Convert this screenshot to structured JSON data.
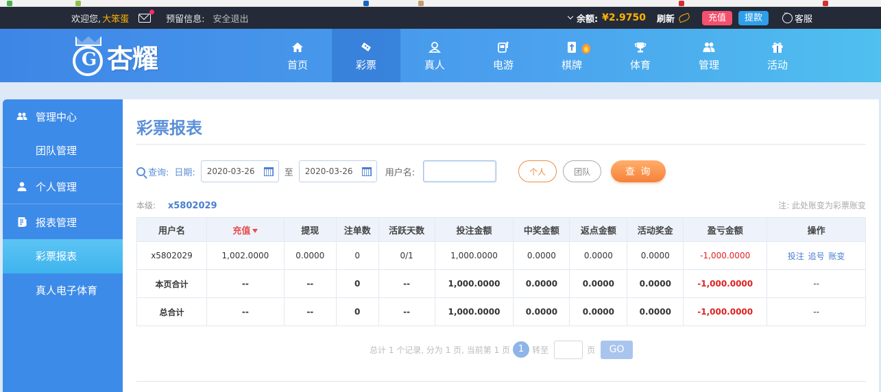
{
  "topbar": {
    "welcome": "欢迎您,",
    "username": "大笨蛋",
    "notice_label": "预留信息:",
    "logout": "安全退出",
    "balance_label": "余额:",
    "balance_value": "¥2.9750",
    "refresh": "刷新",
    "recharge": "充值",
    "withdraw": "提款",
    "service": "客服"
  },
  "logo": {
    "text": "杏耀"
  },
  "nav": [
    {
      "label": "首页",
      "icon": "home-icon"
    },
    {
      "label": "彩票",
      "icon": "ticket-icon"
    },
    {
      "label": "真人",
      "icon": "live-dealer-icon"
    },
    {
      "label": "电游",
      "icon": "slot-machine-icon"
    },
    {
      "label": "棋牌",
      "icon": "mahjong-icon"
    },
    {
      "label": "体育",
      "icon": "trophy-icon"
    },
    {
      "label": "管理",
      "icon": "users-icon"
    },
    {
      "label": "活动",
      "icon": "gift-icon"
    }
  ],
  "sidebar": {
    "management_center": "管理中心",
    "team_management": "团队管理",
    "personal_management": "个人管理",
    "report_management": "报表管理",
    "lottery_report": "彩票报表",
    "live_sports": "真人电子体育"
  },
  "main": {
    "title": "彩票报表",
    "query_label": "查询:",
    "date_label": "日期:",
    "date_from": "2020-03-26",
    "to_label": "至",
    "date_to": "2020-03-26",
    "username_label": "用户名:",
    "username_value": "",
    "btn_personal": "个人",
    "btn_team": "团队",
    "btn_query": "查 询",
    "level_label": "本级:",
    "level_user": "x5802029",
    "note": "注: 此处账变为彩票账变"
  },
  "table": {
    "headers": [
      "用户名",
      "充值",
      "提现",
      "注单数",
      "活跃天数",
      "投注金额",
      "中奖金额",
      "返点金额",
      "活动奖金",
      "盈亏金额",
      "操作"
    ],
    "row": [
      "x5802029",
      "1,002.0000",
      "0.0000",
      "0",
      "0/1",
      "1,000.0000",
      "0.0000",
      "0.0000",
      "0.0000",
      "-1,000.0000"
    ],
    "ops": [
      "投注",
      "追号",
      "账变"
    ],
    "page_total": [
      "本页合计",
      "--",
      "--",
      "0",
      "--",
      "1,000.0000",
      "0.0000",
      "0.0000",
      "0.0000",
      "-1,000.0000",
      "--"
    ],
    "grand_total": [
      "总合计",
      "--",
      "--",
      "0",
      "--",
      "1,000.0000",
      "0.0000",
      "0.0000",
      "0.0000",
      "-1,000.0000",
      "--"
    ]
  },
  "pager": {
    "summary": "总计 1 个记录, 分为 1 页, 当前第 1 页",
    "current_page": "1",
    "jump_label": "转至",
    "page_unit": "页",
    "go": "GO"
  },
  "colors": {
    "accent": "#3d8be8",
    "active_sidebar": "#4fbcf1",
    "balance": "#ffb400",
    "negative": "#e02020",
    "query_button": "#f5813a"
  }
}
